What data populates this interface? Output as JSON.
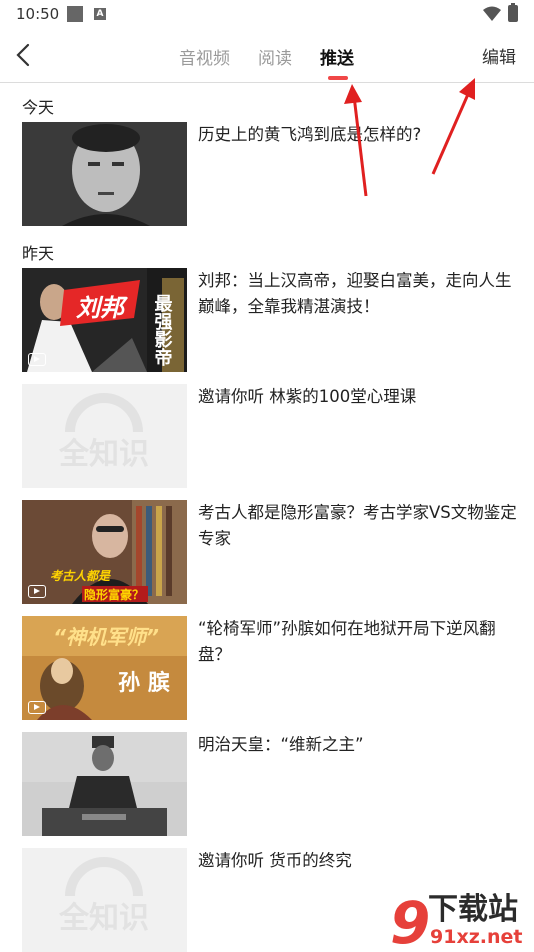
{
  "status": {
    "time": "10:50",
    "a_icon_label": "A"
  },
  "nav": {
    "tabs": [
      "音视频",
      "阅读",
      "推送"
    ],
    "active_tab": "推送",
    "edit": "编辑",
    "accent_color": "#f04747"
  },
  "sections": {
    "today": "今天",
    "yesterday": "昨天"
  },
  "items": [
    {
      "title": "历史上的黄飞鸿到底是怎样的?",
      "has_video": false
    },
    {
      "title": "刘邦：当上汉高帝，迎娶白富美，走向人生巅峰，全靠我精湛演技！",
      "has_video": true,
      "thumb_text": "刘邦",
      "thumb_side_text": "最强影帝"
    },
    {
      "title": "邀请你听 林紫的100堂心理课",
      "has_video": false,
      "thumb_text": "全知识"
    },
    {
      "title": "考古人都是隐形富豪？考古学家VS文物鉴定专家",
      "has_video": true,
      "thumb_text": "考古人都是",
      "thumb_text2": "隐形富豪？"
    },
    {
      "title": "“轮椅军师”孙膑如何在地狱开局下逆风翻盘？",
      "has_video": true,
      "thumb_text": "“神机军师”",
      "thumb_text2": "孙 膑"
    },
    {
      "title": "明治天皇：“维新之主”",
      "has_video": false
    },
    {
      "title": "邀请你听 货币的终究",
      "has_video": false,
      "thumb_text": "全知识"
    }
  ],
  "watermark": {
    "text1": "下载站",
    "text2": "91xz.net"
  }
}
